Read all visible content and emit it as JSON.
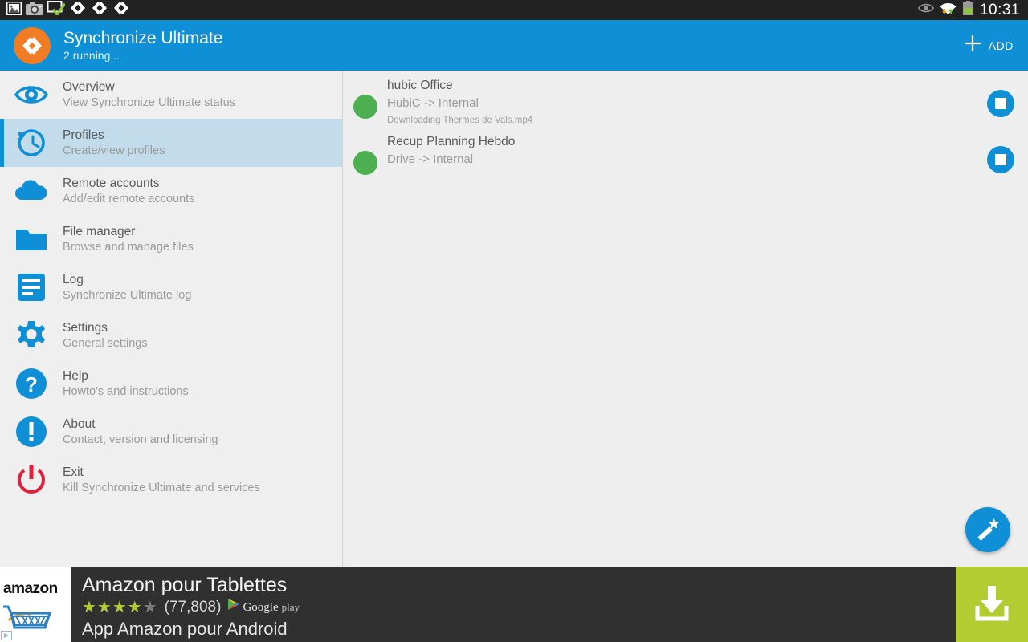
{
  "status_bar": {
    "time": "10:31",
    "left_icons": [
      {
        "name": "gallery-image-icon"
      },
      {
        "name": "camera-icon"
      },
      {
        "name": "screenshot-captured-icon"
      },
      {
        "name": "sync-notification-icon-1"
      },
      {
        "name": "sync-notification-icon-2"
      },
      {
        "name": "sync-notification-icon-3"
      }
    ],
    "right_icons": [
      {
        "name": "eye-visibility-icon"
      },
      {
        "name": "wifi-data-transfer-icon"
      },
      {
        "name": "battery-icon"
      }
    ]
  },
  "appbar": {
    "logo_name": "synchronize-ultimate-logo",
    "title": "Synchronize Ultimate",
    "subtitle": "2 running...",
    "add_label": "ADD",
    "accent_color": "#0f8fd6",
    "logo_color": "#f07c23"
  },
  "sidebar": {
    "items": [
      {
        "icon": "eye-icon",
        "title": "Overview",
        "subtitle": "View Synchronize Ultimate status",
        "selected": false
      },
      {
        "icon": "history-clock-icon",
        "title": "Profiles",
        "subtitle": "Create/view profiles",
        "selected": true
      },
      {
        "icon": "cloud-icon",
        "title": "Remote accounts",
        "subtitle": "Add/edit remote accounts",
        "selected": false
      },
      {
        "icon": "folder-icon",
        "title": "File manager",
        "subtitle": "Browse and manage files",
        "selected": false
      },
      {
        "icon": "log-document-icon",
        "title": "Log",
        "subtitle": "Synchronize Ultimate log",
        "selected": false
      },
      {
        "icon": "gear-icon",
        "title": "Settings",
        "subtitle": "General settings",
        "selected": false
      },
      {
        "icon": "question-mark-icon",
        "title": "Help",
        "subtitle": "Howto's and instructions",
        "selected": false
      },
      {
        "icon": "info-exclamation-icon",
        "title": "About",
        "subtitle": "Contact, version and licensing",
        "selected": false
      },
      {
        "icon": "power-off-icon",
        "title": "Exit",
        "subtitle": "Kill Synchronize Ultimate and services",
        "selected": false
      }
    ],
    "selected_bg": "#c3dcec",
    "exit_icon_color": "#e0203c"
  },
  "main": {
    "profiles": [
      {
        "name": "hubic Office",
        "route": "HubiC -> Internal",
        "status": "Downloading Thermes de Vals.mp4",
        "progress_percent": 0,
        "state_color": "#4caf50",
        "stop_label": "stop"
      },
      {
        "name": "Recup Planning Hebdo",
        "route": "Drive -> Internal",
        "status": "",
        "progress_percent": 0,
        "state_color": "#4caf50",
        "stop_label": "stop"
      }
    ],
    "fab_icon": "magic-wand-icon"
  },
  "ad": {
    "thumb_brand": "amazon",
    "title": "Amazon pour Tablettes",
    "stars_filled": 4,
    "stars_total": 5,
    "rating_count": "(77,808)",
    "store_name": "Google",
    "store_name_2": "play",
    "description": "App Amazon pour Android",
    "install_icon": "download-icon",
    "install_color": "#b2cc32",
    "background_color": "#303030"
  }
}
